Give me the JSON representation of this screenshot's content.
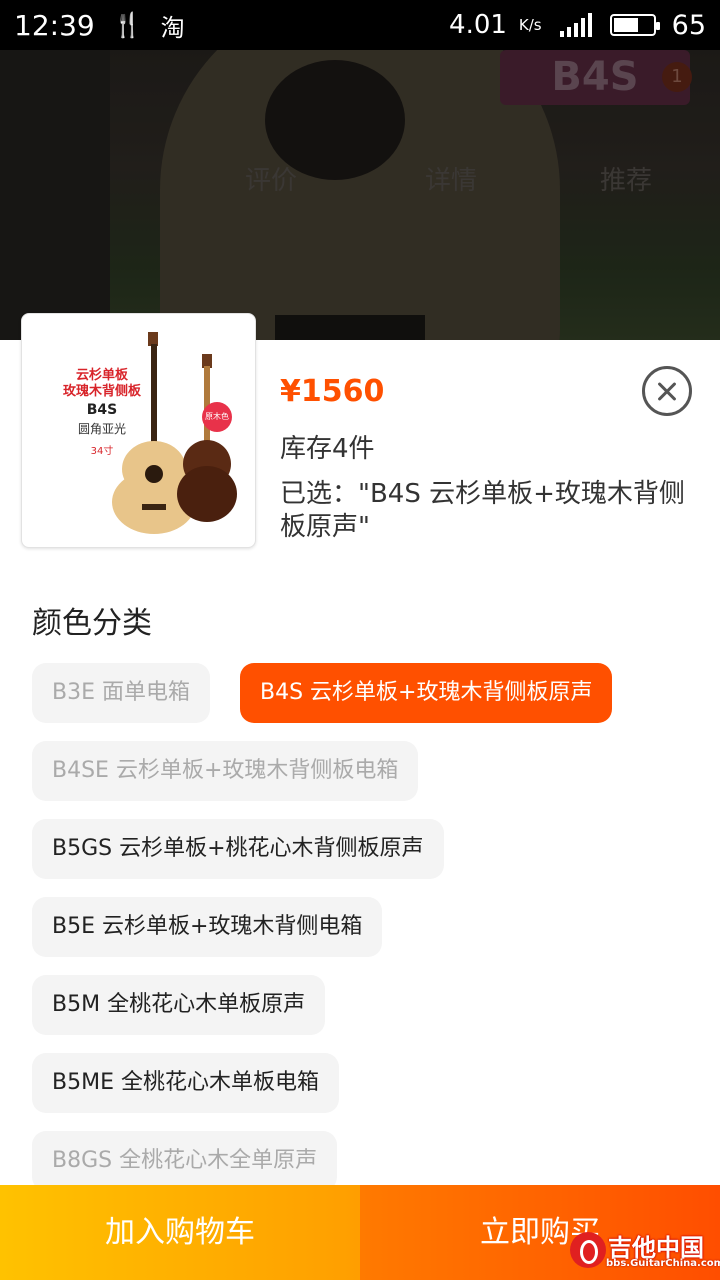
{
  "status_bar": {
    "time": "12:39",
    "app_icon_1": "utensils-icon",
    "app_icon_2": "淘",
    "speed": "4.01",
    "speed_unit": "K/s",
    "network": "4G",
    "battery_percent": "65",
    "battery_level": 0.65
  },
  "background_page": {
    "logo_text": "B4S",
    "cart_badge": "1",
    "tabs": [
      "评价",
      "详情",
      "推荐"
    ]
  },
  "product": {
    "image_text": {
      "line1": "云杉单板",
      "line2": "玫瑰木背侧板",
      "model": "B4S",
      "finish": "圆角亚光",
      "size": "34寸",
      "badge": "原木色"
    },
    "price": "¥1560",
    "stock": "库存4件",
    "selected": "已选：\"B4S 云杉单板+玫瑰木背侧板原声\""
  },
  "colors": {
    "title": "颜色分类",
    "options": [
      {
        "label": "B3E 面单电箱",
        "state": "disabled"
      },
      {
        "label": "B4S 云杉单板+玫瑰木背侧板原声",
        "state": "selected"
      },
      {
        "label": "B4SE 云杉单板+玫瑰木背侧板电箱",
        "state": "disabled"
      },
      {
        "label": "B5GS 云杉单板+桃花心木背侧板原声",
        "state": "available"
      },
      {
        "label": "B5E 云杉单板+玫瑰木背侧电箱",
        "state": "available"
      },
      {
        "label": "B5M 全桃花心木单板原声",
        "state": "available"
      },
      {
        "label": "B5ME 全桃花心木单板电箱",
        "state": "available"
      },
      {
        "label": "B8GS 全桃花心木全单原声",
        "state": "disabled"
      }
    ]
  },
  "actions": {
    "add_to_cart": "加入购物车",
    "buy_now": "立即购买"
  },
  "watermark": {
    "title": "吉他中国",
    "url": "bbs.GuitarChina.com"
  },
  "theme": {
    "accent": "#ff5000",
    "cart_gradient": [
      "#ffc200",
      "#ff9e00"
    ],
    "buy_gradient": [
      "#ff7a00",
      "#ff4e00"
    ]
  }
}
